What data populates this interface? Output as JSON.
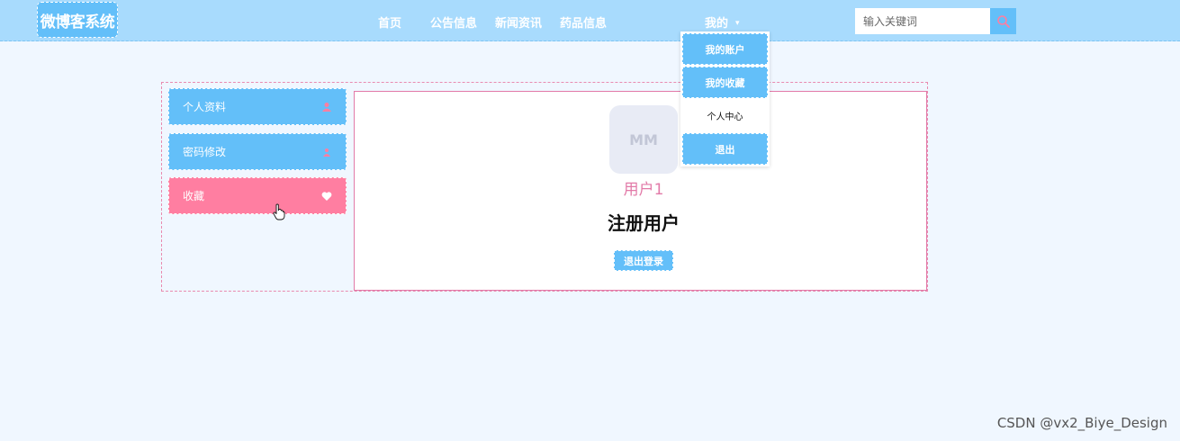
{
  "header": {
    "logo": "微博客系统",
    "nav": [
      "首页",
      "公告信息",
      "新闻资讯",
      "药品信息"
    ],
    "mine_label": "我的",
    "search_placeholder": "输入关键词",
    "search_icon": "search-icon"
  },
  "dropdown": {
    "items": [
      "我的账户",
      "我的收藏",
      "个人中心",
      "退出"
    ]
  },
  "sidebar": {
    "items": [
      {
        "label": "个人资料",
        "icon": "person-icon"
      },
      {
        "label": "密码修改",
        "icon": "person-icon"
      },
      {
        "label": "收藏",
        "icon": "heart-icon"
      }
    ]
  },
  "profile": {
    "avatar_text": "MM",
    "username": "用户1",
    "role": "注册用户",
    "logout_label": "退出登录"
  },
  "watermark": "CSDN @vx2_Biye_Design",
  "colors": {
    "header_bg": "#a8dbfd",
    "primary": "#63bff9",
    "accent_pink": "#ff7ea1",
    "page_bg": "#f0f7ff"
  }
}
